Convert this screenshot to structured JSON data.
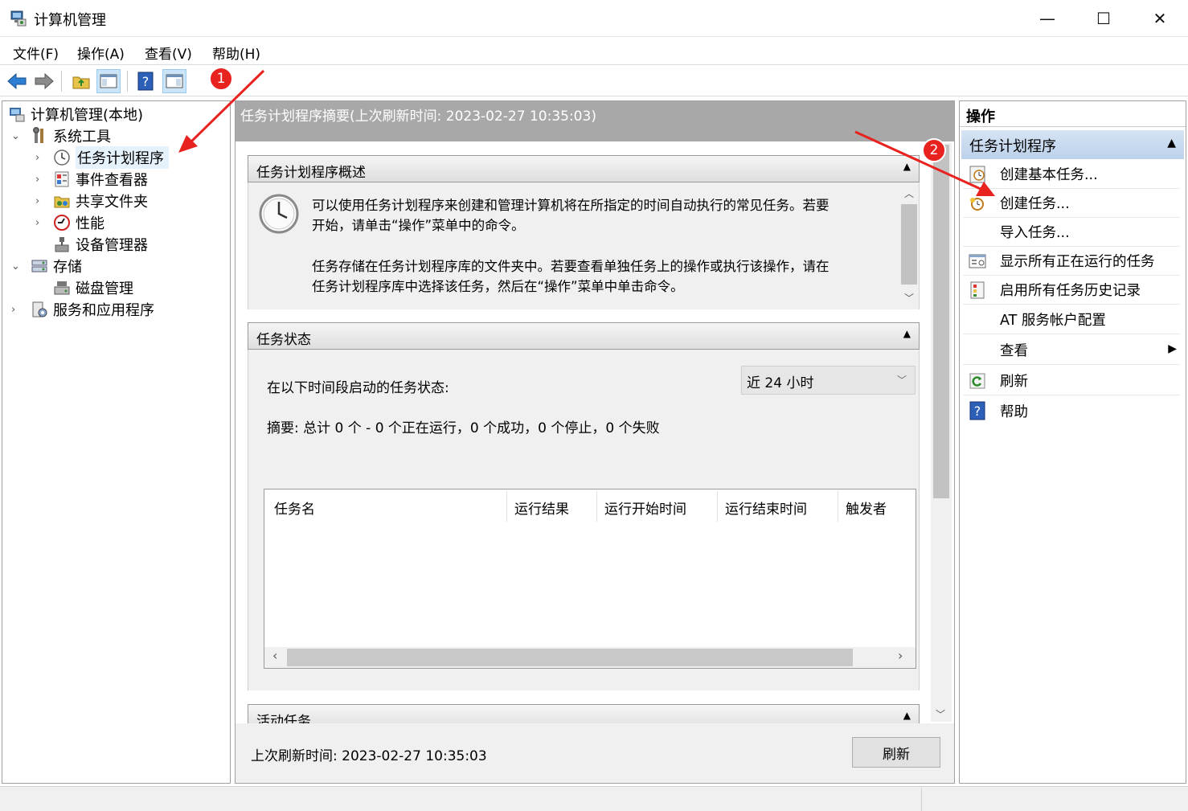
{
  "window": {
    "title": "计算机管理",
    "controls": {
      "minimize": "—",
      "maximize": "☐",
      "close": "✕"
    }
  },
  "menu": [
    "文件(F)",
    "操作(A)",
    "查看(V)",
    "帮助(H)"
  ],
  "toolbar": [
    "back-arrow-icon",
    "forward-arrow-icon",
    "up-folder-icon",
    "show-hide-tree-icon",
    "help-icon",
    "properties-pane-icon"
  ],
  "tree": {
    "root": "计算机管理(本地)",
    "system_tools": "系统工具",
    "task_scheduler": "任务计划程序",
    "event_viewer": "事件查看器",
    "shared_folders": "共享文件夹",
    "performance": "性能",
    "device_manager": "设备管理器",
    "storage": "存储",
    "disk_management": "磁盘管理",
    "services_apps": "服务和应用程序"
  },
  "center": {
    "header": "任务计划程序摘要(上次刷新时间: 2023-02-27 10:35:03)",
    "overview": {
      "title": "任务计划程序概述",
      "para1_line1": "可以使用任务计划程序来创建和管理计算机将在所指定的时间自动执行的常见任务。若要",
      "para1_line2": "开始，请单击“操作”菜单中的命令。",
      "para2_line1": "任务存储在任务计划程序库的文件夹中。若要查看单独任务上的操作或执行该操作，请在",
      "para2_line2": "任务计划程序库中选择该任务，然后在“操作”菜单中单击命令。"
    },
    "status": {
      "title": "任务状态",
      "period_label": "在以下时间段启动的任务状态:",
      "period_value": "近 24 小时",
      "summary": "摘要: 总计 0 个 - 0 个正在运行，0 个成功，0 个停止，0 个失败",
      "columns": [
        "任务名",
        "运行结果",
        "运行开始时间",
        "运行结束时间",
        "触发者"
      ]
    },
    "active_tasks_title": "活动任务",
    "last_refresh": "上次刷新时间: 2023-02-27 10:35:03",
    "refresh_button": "刷新"
  },
  "actions": {
    "title": "操作",
    "group": "任务计划程序",
    "items": [
      "创建基本任务...",
      "创建任务...",
      "导入任务...",
      "显示所有正在运行的任务",
      "启用所有任务历史记录",
      "AT 服务帐户配置",
      "查看",
      "刷新",
      "帮助"
    ]
  },
  "annotations": {
    "badge1": "1",
    "badge2": "2"
  },
  "colors": {
    "selection": "#e5f1fb",
    "header_gray": "#a8a8a8",
    "badge_red": "#e8221f",
    "arrow_red": "#e8221f"
  }
}
